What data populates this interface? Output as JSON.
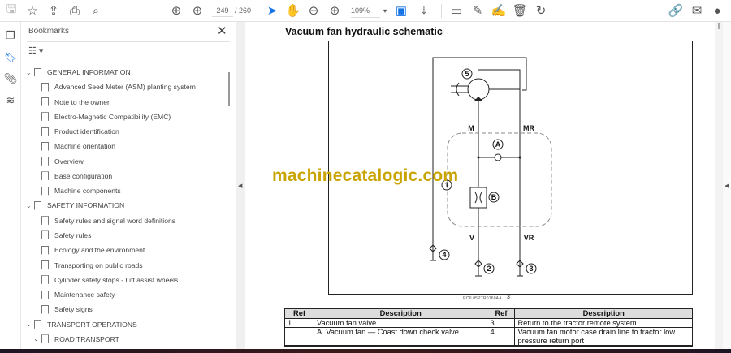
{
  "toolbar": {
    "page_current": "249",
    "page_total": "/ 260",
    "zoom": "109%"
  },
  "panel": {
    "title": "Bookmarks",
    "close": "✕",
    "options": "☷ ▾"
  },
  "bookmarks": [
    {
      "label": "GENERAL INFORMATION",
      "level": 0,
      "expanded": true
    },
    {
      "label": "Advanced Seed Meter (ASM) planting system",
      "level": 2
    },
    {
      "label": "Note to the owner",
      "level": 2
    },
    {
      "label": "Electro-Magnetic Compatibility (EMC)",
      "level": 2
    },
    {
      "label": "Product identification",
      "level": 2
    },
    {
      "label": "Machine orientation",
      "level": 2
    },
    {
      "label": "Overview",
      "level": 2
    },
    {
      "label": "Base configuration",
      "level": 2
    },
    {
      "label": "Machine components",
      "level": 2
    },
    {
      "label": "SAFETY INFORMATION",
      "level": 0,
      "expanded": true
    },
    {
      "label": "Safety rules and signal word definitions",
      "level": 2
    },
    {
      "label": "Safety rules",
      "level": 2
    },
    {
      "label": "Ecology and the environment",
      "level": 2
    },
    {
      "label": "Transporting on public roads",
      "level": 2
    },
    {
      "label": "Cylinder safety stops - Lift assist wheels",
      "level": 2
    },
    {
      "label": "Maintenance safety",
      "level": 2
    },
    {
      "label": "Safety signs",
      "level": 2
    },
    {
      "label": "TRANSPORT OPERATIONS",
      "level": 0,
      "expanded": true
    },
    {
      "label": "ROAD TRANSPORT",
      "level": 1,
      "expanded": true
    }
  ],
  "document": {
    "title": "Vacuum fan hydraulic schematic",
    "watermark": "machinecatalogic.com",
    "caption": "RCIL05PTR0160AA",
    "caption_num": "3",
    "diagram_labels": {
      "five": "5",
      "m": "M",
      "mr": "MR",
      "a": "A",
      "b": "B",
      "one": "1",
      "v": "V",
      "vr": "VR",
      "two": "2",
      "three": "3",
      "four": "4"
    },
    "table": {
      "headers": [
        "Ref",
        "Description",
        "Ref",
        "Description"
      ],
      "rows": [
        [
          "1",
          "Vacuum fan valve",
          "3",
          "Return to the tractor remote system"
        ],
        [
          "",
          "A. Vacuum fan — Coast down check valve",
          "4",
          "Vacuum fan motor case drain line to tractor low pressure return port"
        ],
        [
          "",
          "",
          "",
          ""
        ]
      ]
    }
  }
}
